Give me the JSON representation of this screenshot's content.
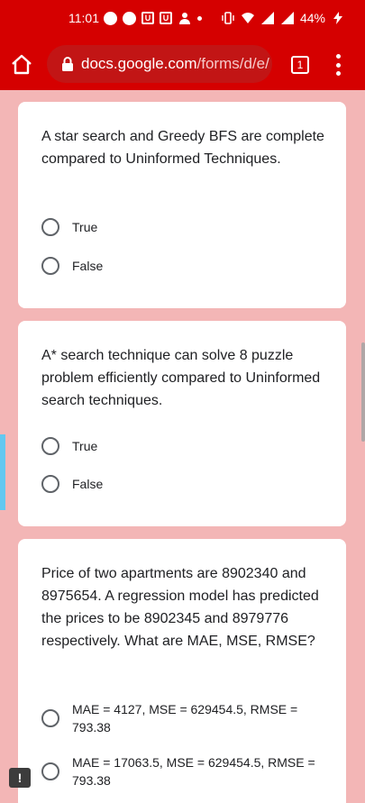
{
  "status_bar": {
    "time": "11:01",
    "battery": "44%",
    "left_icons": [
      "message-icon",
      "messenger-icon",
      "app-u-icon",
      "app-u-icon",
      "person-icon",
      "dot-icon"
    ],
    "right_icons": [
      "vibrate-icon",
      "wifi-icon",
      "signal-icon",
      "signal-icon",
      "charging-icon"
    ]
  },
  "toolbar": {
    "url_host": "docs.google.com",
    "url_path": "/forms/d/e/",
    "tab_count": "1"
  },
  "questions": [
    {
      "text": "A star search and Greedy BFS are complete compared to Uninformed Techniques.",
      "options": [
        "True",
        "False"
      ]
    },
    {
      "text": "A* search technique can solve 8 puzzle problem efficiently compared to Uninformed search techniques.",
      "options": [
        "True",
        "False"
      ]
    },
    {
      "text": "Price of two apartments are 8902340 and 8975654. A regression model has predicted the prices to be 8902345 and 8979776 respectively. What are MAE, MSE, RMSE?",
      "options": [
        "MAE = 4127, MSE = 629454.5, RMSE = 793.38",
        "MAE = 17063.5, MSE = 629454.5, RMSE = 793.38"
      ]
    }
  ],
  "feedback_label": "!",
  "colors": {
    "brand_red": "#d50000",
    "page_bg": "#f3b6b6"
  }
}
